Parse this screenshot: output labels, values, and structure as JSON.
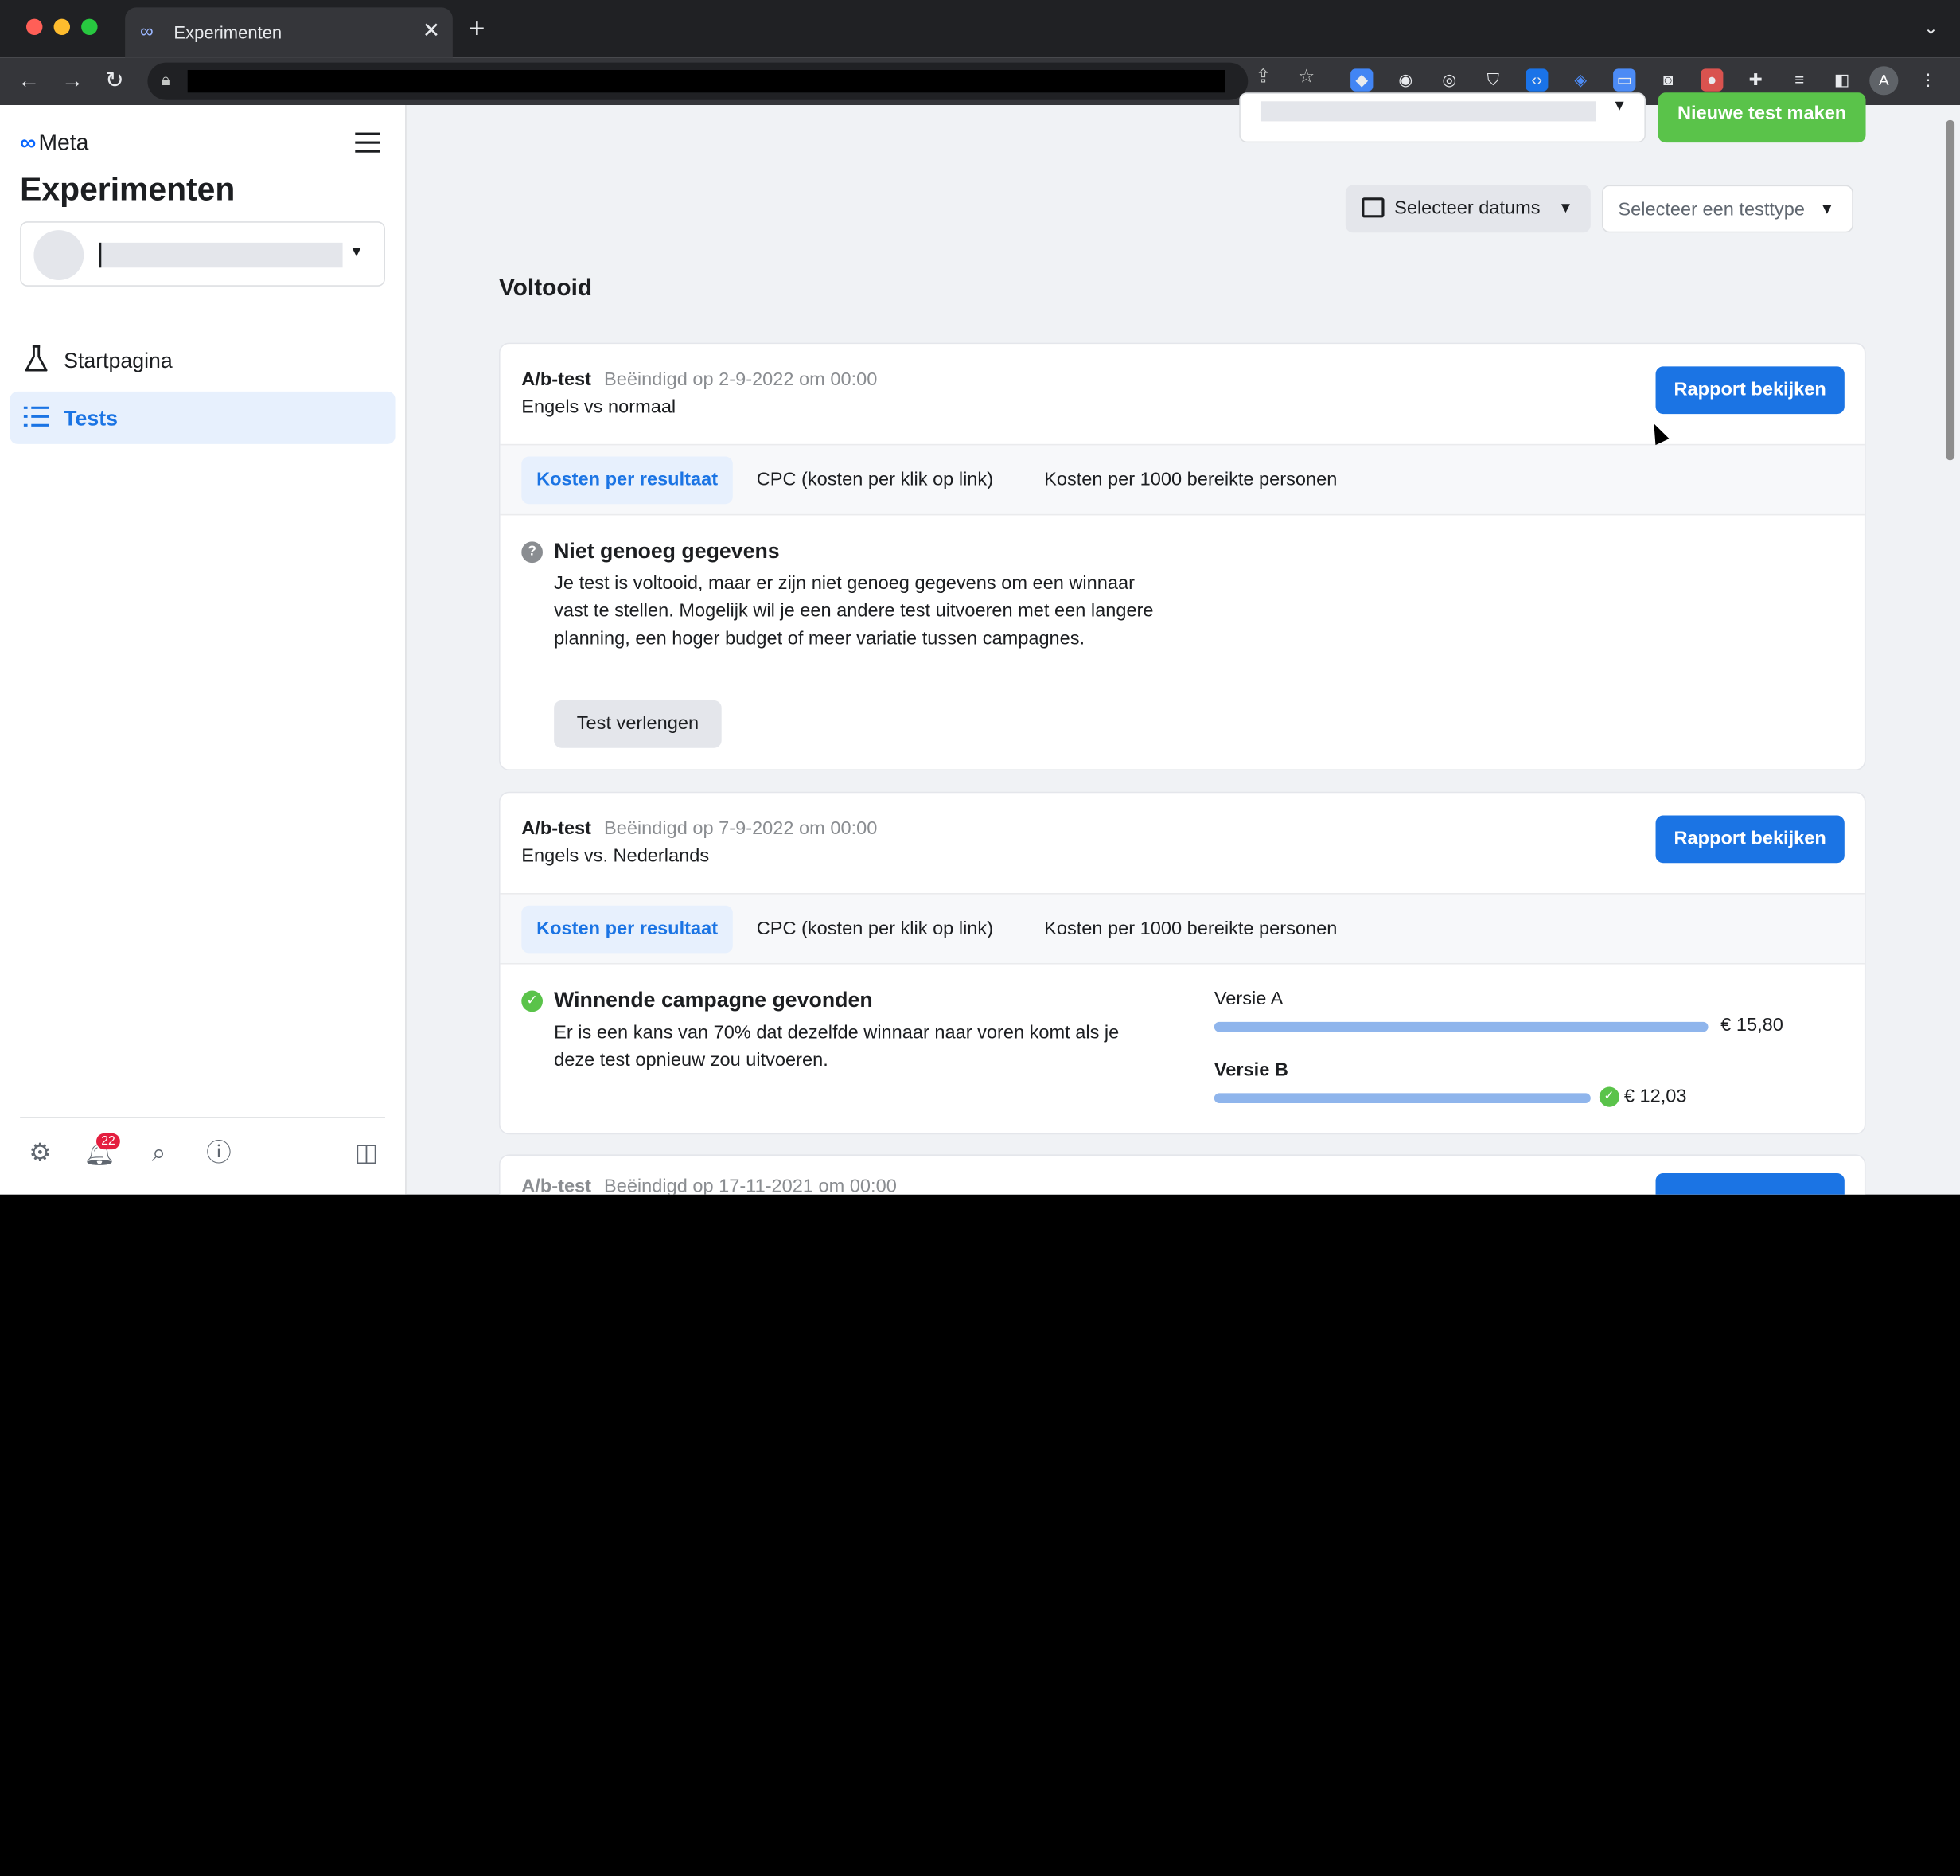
{
  "browser": {
    "tab_title": "Experimenten",
    "new_tab": "+",
    "close": "✕",
    "profile_initial": "A"
  },
  "sidebar": {
    "brand": "Meta",
    "app_title": "Experimenten",
    "nav": [
      {
        "label": "Startpagina",
        "icon": "flask-icon"
      },
      {
        "label": "Tests",
        "icon": "list-icon",
        "active": true
      }
    ],
    "notification_count": "22"
  },
  "main": {
    "new_test_button": "Nieuwe test maken",
    "date_filter": "Selecteer datums",
    "type_filter": "Selecteer een testtype",
    "section_title": "Voltooid",
    "metric_tabs": [
      "Kosten per resultaat",
      "CPC (kosten per klik op link)",
      "Kosten per 1000 bereikte personen"
    ],
    "cards": [
      {
        "type": "A/b-test",
        "ended": "Beëindigd op 2-9-2022 om 00:00",
        "name": "Engels vs normaal",
        "report_button": "Rapport bekijken",
        "status_title": "Niet genoeg gegevens",
        "status_body": "Je test is voltooid, maar er zijn niet genoeg gegevens om een winnaar vast te stellen. Mogelijk wil je een andere test uitvoeren met een langere planning, een hoger budget of meer variatie tussen campagnes.",
        "extend_button": "Test verlengen"
      },
      {
        "type": "A/b-test",
        "ended": "Beëindigd op 7-9-2022 om 00:00",
        "name": "Engels vs. Nederlands",
        "report_button": "Rapport bekijken",
        "status_title": "Winnende campagne gevonden",
        "status_body": "Er is een kans van 70% dat dezelfde winnaar naar voren komt als je deze test opnieuw zou uitvoeren.",
        "versions": [
          {
            "label": "Versie A",
            "value": "€ 15,80",
            "amount": 15.8,
            "winner": false
          },
          {
            "label": "Versie B",
            "value": "€ 12,03",
            "amount": 12.03,
            "winner": true
          }
        ]
      },
      {
        "type": "A/b-test",
        "ended": "Beëindigd op 17-11-2021 om 00:00"
      }
    ]
  },
  "colors": {
    "primary": "#1b74e4",
    "success": "#5ac34a",
    "bar": "#8fb5ec"
  }
}
